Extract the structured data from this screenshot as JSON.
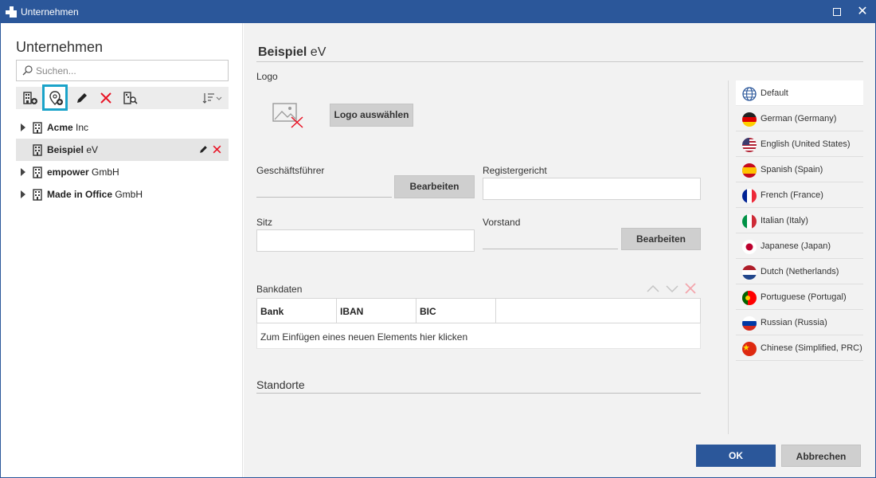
{
  "window": {
    "title": "Unternehmen"
  },
  "sidebar": {
    "title": "Unternehmen",
    "search_placeholder": "Suchen...",
    "toolbar": [
      "add-company-icon",
      "add-location-icon",
      "edit-icon",
      "delete-icon",
      "find-company-icon",
      "sort-icon"
    ],
    "companies": [
      {
        "name_bold": "Acme",
        "name_rest": " Inc",
        "expandable": true,
        "selected": false
      },
      {
        "name_bold": "Beispiel",
        "name_rest": " eV",
        "expandable": false,
        "selected": true
      },
      {
        "name_bold": "empower",
        "name_rest": " GmbH",
        "expandable": true,
        "selected": false
      },
      {
        "name_bold": "Made in Office",
        "name_rest": " GmbH",
        "expandable": true,
        "selected": false
      }
    ]
  },
  "main": {
    "title_bold": "Beispiel",
    "title_rest": " eV",
    "logo_label": "Logo",
    "logo_button": "Logo auswählen",
    "managing_director_label": "Geschäftsführer",
    "managing_director_button": "Bearbeiten",
    "register_court_label": "Registergericht",
    "register_court_value": "",
    "seat_label": "Sitz",
    "seat_value": "",
    "board_label": "Vorstand",
    "board_button": "Bearbeiten",
    "bank_label": "Bankdaten",
    "bank_columns": [
      "Bank",
      "IBAN",
      "BIC"
    ],
    "bank_new_row": "Zum Einfügen eines neuen Elements hier klicken",
    "locations_label": "Standorte"
  },
  "languages": [
    {
      "label": "Default",
      "flag": "globe",
      "active": true
    },
    {
      "label": "German (Germany)",
      "flag": "de"
    },
    {
      "label": "English (United States)",
      "flag": "us"
    },
    {
      "label": "Spanish (Spain)",
      "flag": "es"
    },
    {
      "label": "French (France)",
      "flag": "fr"
    },
    {
      "label": "Italian (Italy)",
      "flag": "it"
    },
    {
      "label": "Japanese (Japan)",
      "flag": "jp"
    },
    {
      "label": "Dutch (Netherlands)",
      "flag": "nl"
    },
    {
      "label": "Portuguese (Portugal)",
      "flag": "pt"
    },
    {
      "label": "Russian (Russia)",
      "flag": "ru"
    },
    {
      "label": "Chinese (Simplified, PRC)",
      "flag": "cn"
    }
  ],
  "footer": {
    "ok": "OK",
    "cancel": "Abbrechen"
  },
  "colors": {
    "accent": "#2b579a",
    "highlight": "#1aa3c9",
    "delete": "#e81123"
  }
}
